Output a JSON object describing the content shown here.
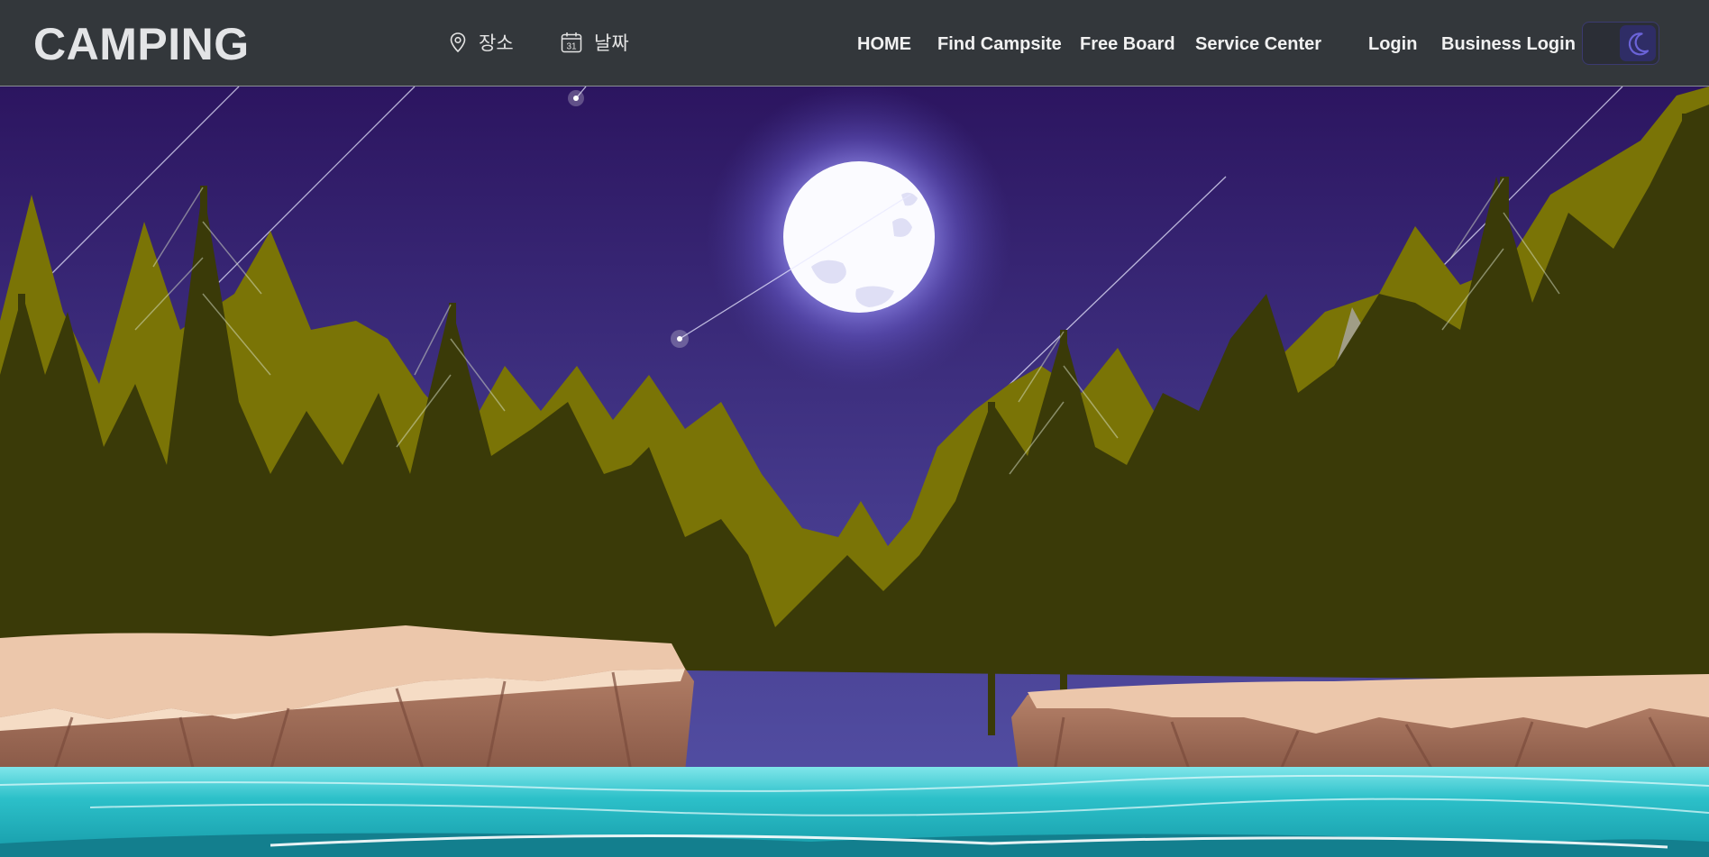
{
  "brand": {
    "logo_text": "CAMPING"
  },
  "filters": {
    "place_label": "장소",
    "place_icon": "map-pin-icon",
    "date_label": "날짜",
    "date_icon": "calendar-icon",
    "calendar_day": "31"
  },
  "nav": {
    "home": "HOME",
    "find_campsite": "Find Campsite",
    "free_board": "Free Board",
    "service_center": "Service Center",
    "login": "Login",
    "business_login": "Business Login"
  },
  "theme_toggle": {
    "mode": "dark",
    "icon": "moon-icon"
  },
  "colors": {
    "navbar": "#33373b",
    "sky_top": "#2c1560",
    "sky_bottom": "#4b4a9e",
    "forest_light": "#7a7406",
    "forest_dark": "#3a3a08",
    "water": "#27b9c2"
  }
}
